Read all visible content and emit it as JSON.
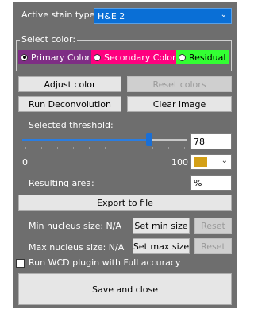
{
  "stain": {
    "label": "Active stain type:",
    "value": "H&E 2"
  },
  "colors": {
    "group_label": "Select color:",
    "options": [
      {
        "label": "Primary Color",
        "selected": true,
        "color": "#7e2e84"
      },
      {
        "label": "Secondary Color",
        "selected": false,
        "color": "#ff007f"
      },
      {
        "label": "Residual",
        "selected": false,
        "color": "#33ff33"
      }
    ]
  },
  "buttons": {
    "adjust_color": "Adjust color",
    "reset_colors": "Reset colors",
    "run_deconvolution": "Run Deconvolution",
    "clear_image": "Clear image",
    "export": "Export to file",
    "set_min_size": "Set min size",
    "set_max_size": "Set max size",
    "reset_min": "Reset",
    "reset_max": "Reset",
    "save_close": "Save and close"
  },
  "threshold": {
    "label": "Selected threshold:",
    "value": "78",
    "min_label": "0",
    "max_label": "100",
    "fraction": 0.78,
    "overlay_color": "#d4a017"
  },
  "area": {
    "label": "Resulting area:",
    "value": "%"
  },
  "nucleus": {
    "min_label": "Min nucleus size: N/A",
    "max_label": "Max nucleus size: N/A"
  },
  "wcd": {
    "label": "Run WCD plugin with Full accuracy",
    "checked": false
  }
}
